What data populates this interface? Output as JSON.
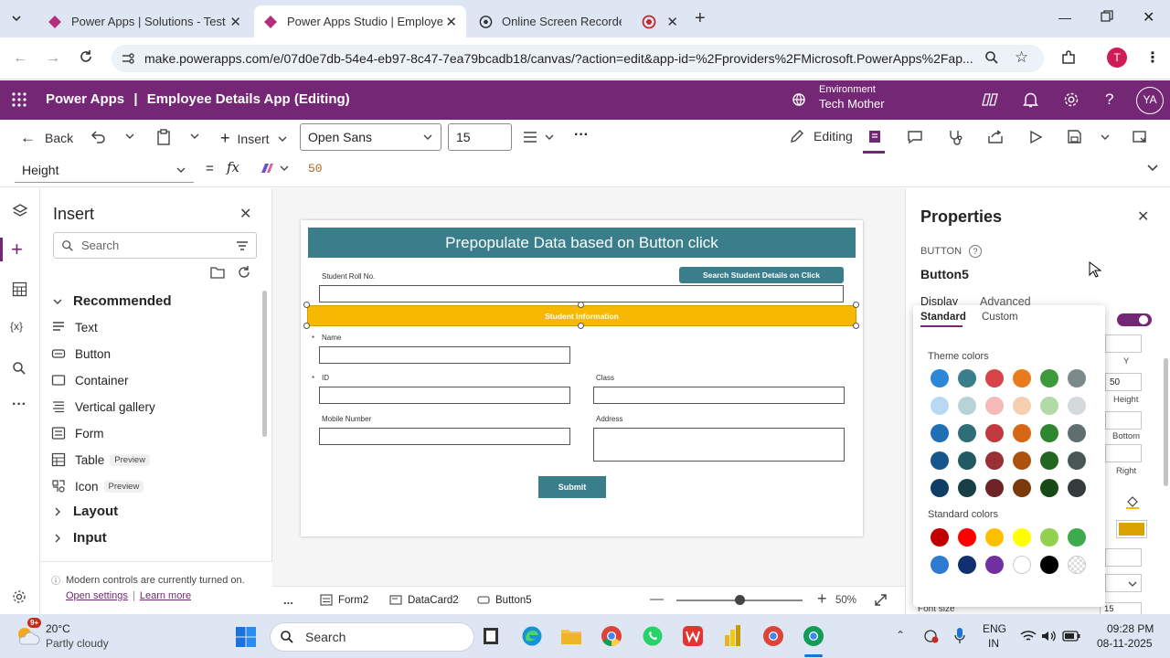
{
  "browser": {
    "tabs": [
      {
        "title": "Power Apps | Solutions - Test App"
      },
      {
        "title": "Power Apps Studio | Employee Details"
      },
      {
        "title": "Online Screen Recorder"
      }
    ],
    "url": "make.powerapps.com/e/07d0e7db-54e4-eb97-8c47-7ea79bcadb18/canvas/?action=edit&app-id=%2Fproviders%2FMicrosoft.PowerApps%2Fap...",
    "profile_initial": "T"
  },
  "app": {
    "brand": "Power Apps",
    "separator": "|",
    "title": "Employee Details App (Editing)",
    "environment_label": "Environment",
    "environment_name": "Tech Mother",
    "user_initials": "YA"
  },
  "toolbar": {
    "back": "Back",
    "insert": "Insert",
    "font": "Open Sans",
    "font_size": "15",
    "editing": "Editing"
  },
  "formula": {
    "property": "Height",
    "equals": "=",
    "fx": "fx",
    "value": "50"
  },
  "insert_pane": {
    "title": "Insert",
    "search_placeholder": "Search",
    "section": "Recommended",
    "items": [
      {
        "label": "Text"
      },
      {
        "label": "Button"
      },
      {
        "label": "Container"
      },
      {
        "label": "Vertical gallery"
      },
      {
        "label": "Form"
      },
      {
        "label": "Table",
        "badge": "Preview"
      },
      {
        "label": "Icon",
        "badge": "Preview"
      }
    ],
    "groups": [
      "Layout",
      "Input"
    ],
    "note": "Modern controls are currently turned on.",
    "open_settings": "Open settings",
    "pipe": "|",
    "learn_more": "Learn more"
  },
  "screen": {
    "header": "Prepopulate Data based on Button click",
    "roll_label": "Student Roll No.",
    "search_button": "Search Student Details on Click",
    "info_bar": "Student Information",
    "name_label": "Name",
    "id_label": "ID",
    "class_label": "Class",
    "mobile_label": "Mobile Number",
    "address_label": "Address",
    "submit": "Submit",
    "required": "*"
  },
  "bottom_bar": {
    "more": "...",
    "crumbs": [
      "Form2",
      "DataCard2",
      "Button5"
    ],
    "zoom": "50%",
    "zoom_level": 0.5
  },
  "properties": {
    "title": "Properties",
    "type": "BUTTON",
    "name": "Button5",
    "tabs": [
      "Display",
      "Advanced"
    ],
    "partial": {
      "y_label": "Y",
      "y_value": "50",
      "height_label": "Height",
      "bottom_label": "Bottom",
      "right_label": "Right",
      "font_size_label": "Font size",
      "font_size_value": "15"
    }
  },
  "color_picker": {
    "tabs": [
      "Standard",
      "Custom"
    ],
    "theme_label": "Theme colors",
    "standard_label": "Standard colors",
    "theme_rows": [
      [
        "#2e86d6",
        "#3a7e8c",
        "#d9434a",
        "#ea7a1e",
        "#3c9a3c",
        "#7a8a8a"
      ],
      [
        "#b9d8f3",
        "#b6d4d8",
        "#f4b9b9",
        "#f7cfae",
        "#b2d9a6",
        "#d4dadb"
      ],
      [
        "#1f6fb5",
        "#2e6e78",
        "#c03a3f",
        "#d76614",
        "#2e862e",
        "#5f6e6e"
      ],
      [
        "#17558c",
        "#215a62",
        "#993035",
        "#ad5110",
        "#216621",
        "#4a5555"
      ],
      [
        "#103d66",
        "#173f45",
        "#6e2326",
        "#7a3a0b",
        "#174a17",
        "#343c3c"
      ]
    ],
    "standard_rows": [
      [
        "#c00000",
        "#ff0000",
        "#ffc000",
        "#ffff00",
        "#92d050",
        "#3daa4c"
      ],
      [
        "#2f7bd0",
        "#10306e",
        "#7030a0",
        "#ffffff",
        "#000000",
        "transparent"
      ]
    ]
  },
  "taskbar": {
    "temp": "20°C",
    "weather": "Partly cloudy",
    "search": "Search",
    "lang1": "ENG",
    "lang2": "IN",
    "time": "09:28 PM",
    "date": "08-11-2025",
    "weather_badge": "9+"
  },
  "colors": {
    "brand": "#742774",
    "teal": "#3a7e8c",
    "gold": "#f6b800"
  }
}
